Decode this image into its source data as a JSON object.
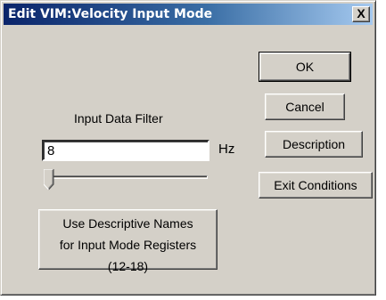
{
  "window": {
    "title": "Edit VIM:Velocity Input Mode",
    "close_label": "X"
  },
  "filter": {
    "label": "Input Data Filter",
    "value": "8",
    "unit": "Hz",
    "slider_level": 0
  },
  "buttons": {
    "ok": "OK",
    "cancel": "Cancel",
    "description": "Description",
    "exit_conditions": "Exit Conditions",
    "descriptive_names_line1": "Use Descriptive Names",
    "descriptive_names_line2": "for Input Mode Registers",
    "descriptive_names_line3": "(12-18)"
  },
  "colors": {
    "titlebar_start": "#0a246a",
    "titlebar_end": "#a6caf0",
    "face": "#d4d0c8"
  }
}
